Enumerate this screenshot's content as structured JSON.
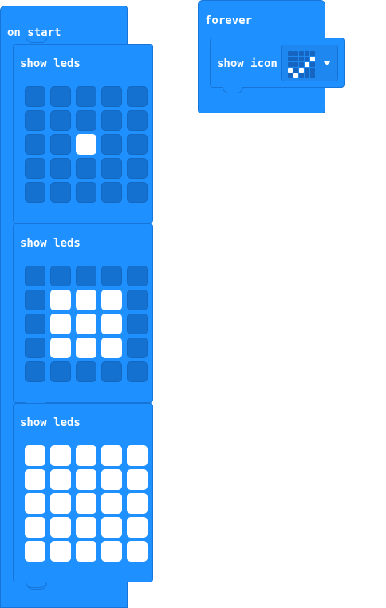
{
  "on_start": {
    "label": "on start",
    "blocks": [
      {
        "label": "show leds",
        "grid": [
          [
            0,
            0,
            0,
            0,
            0
          ],
          [
            0,
            0,
            0,
            0,
            0
          ],
          [
            0,
            0,
            1,
            0,
            0
          ],
          [
            0,
            0,
            0,
            0,
            0
          ],
          [
            0,
            0,
            0,
            0,
            0
          ]
        ]
      },
      {
        "label": "show leds",
        "grid": [
          [
            0,
            0,
            0,
            0,
            0
          ],
          [
            0,
            1,
            1,
            1,
            0
          ],
          [
            0,
            1,
            1,
            1,
            0
          ],
          [
            0,
            1,
            1,
            1,
            0
          ],
          [
            0,
            0,
            0,
            0,
            0
          ]
        ]
      },
      {
        "label": "show leds",
        "grid": [
          [
            1,
            1,
            1,
            1,
            1
          ],
          [
            1,
            1,
            1,
            1,
            1
          ],
          [
            1,
            1,
            1,
            1,
            1
          ],
          [
            1,
            1,
            1,
            1,
            1
          ],
          [
            1,
            1,
            1,
            1,
            1
          ]
        ]
      }
    ]
  },
  "forever": {
    "label": "forever",
    "show_icon": {
      "label": "show icon",
      "selected_icon": "yes-checkmark-icon",
      "icon_grid": [
        [
          0,
          0,
          0,
          0,
          0
        ],
        [
          0,
          0,
          0,
          0,
          1
        ],
        [
          0,
          0,
          0,
          1,
          0
        ],
        [
          1,
          0,
          1,
          0,
          0
        ],
        [
          0,
          1,
          0,
          0,
          0
        ]
      ]
    }
  },
  "colors": {
    "block_blue": "#1e90ff",
    "led_off": "#1571cf",
    "led_on": "#ffffff"
  }
}
